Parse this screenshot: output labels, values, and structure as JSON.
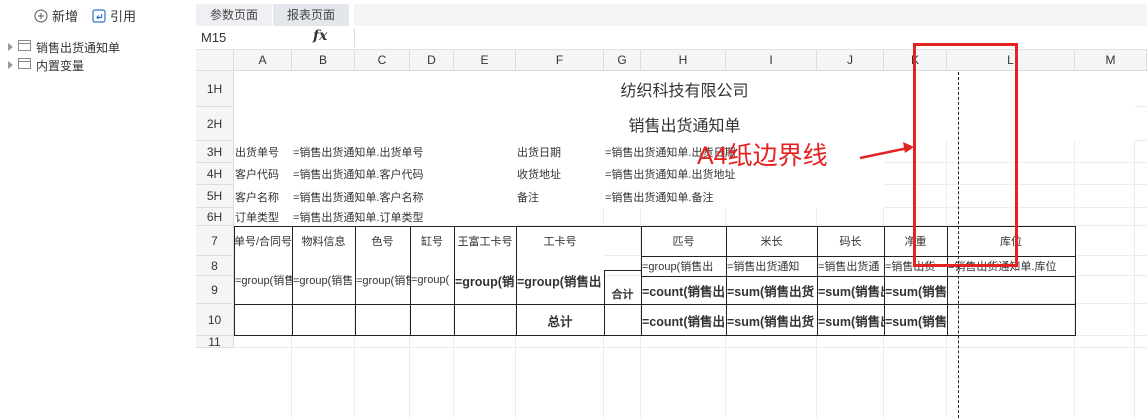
{
  "toolbar": {
    "add_label": "新增",
    "ref_label": "引用"
  },
  "tree": {
    "items": [
      {
        "label": "销售出货通知单"
      },
      {
        "label": "内置变量"
      }
    ]
  },
  "tabs": [
    {
      "label": "参数页面"
    },
    {
      "label": "报表页面"
    }
  ],
  "formula_bar": {
    "cell_ref": "M15",
    "fx": "fx"
  },
  "columns": [
    "A",
    "B",
    "C",
    "D",
    "E",
    "F",
    "G",
    "H",
    "I",
    "J",
    "K",
    "L",
    "M"
  ],
  "rows": [
    "1H",
    "2H",
    "3H",
    "4H",
    "5H",
    "6H",
    "7",
    "8",
    "9",
    "10",
    "11"
  ],
  "cells": {
    "company": "纺织科技有限公司",
    "doc_title": "销售出货通知单",
    "r3a": "出货单号",
    "r3b": "=销售出货通知单.出货单号",
    "r3f": "出货日期",
    "r3g": "=销售出货通知单.出货日期",
    "r4a": "客户代码",
    "r4b": "=销售出货通知单.客户代码",
    "r4f": "收货地址",
    "r4g": "=销售出货通知单.出货地址",
    "r5a": "客户名称",
    "r5b": "=销售出货通知单.客户名称",
    "r5f": "备注",
    "r5g": "=销售出货通知单.备注",
    "r6a": "订单类型",
    "r6b": "=销售出货通知单.订单类型",
    "h7": [
      "单号/合同号",
      "物料信息",
      "色号",
      "缸号",
      "王富工卡号",
      "工卡号",
      "匹号",
      "米长",
      "码长",
      "净重",
      "库位"
    ],
    "g8": [
      "=group(销售出",
      "=group(销售",
      "=group(销售",
      "=group(",
      "=group(销",
      "=group(销售出"
    ],
    "r8": [
      "=group(销售出",
      "=销售出货通知",
      "=销售出货通",
      "=销售出货",
      "=销售出货通知单.库位"
    ],
    "total_label": "合计",
    "r9": [
      "=count(销售出",
      "=sum(销售出货",
      "=sum(销售出",
      "=sum(销售"
    ],
    "grand_total": "总计",
    "r10": [
      "=count(销售出",
      "=sum(销售出货",
      "=sum(销售出",
      "=sum(销售"
    ]
  },
  "annotation": {
    "label": "A4纸边界线",
    "color": "#e52222"
  }
}
